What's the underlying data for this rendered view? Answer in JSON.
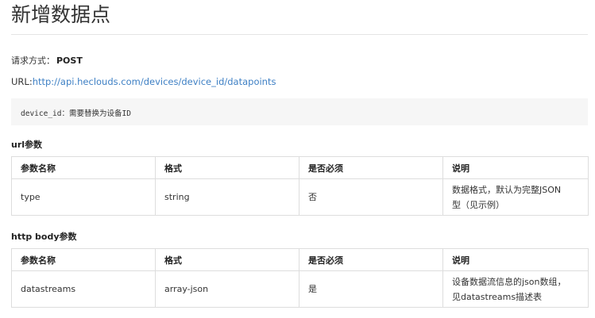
{
  "page": {
    "title": "新增数据点",
    "method_label": "请求方式：",
    "method_value": "POST",
    "url_label": "URL:",
    "url_value": "http://api.heclouds.com/devices/device_id/datapoints",
    "code_note": "device_id：需要替换为设备ID"
  },
  "url_params": {
    "heading": "url参数",
    "headers": [
      "参数名称",
      "格式",
      "是否必须",
      "说明"
    ],
    "rows": [
      {
        "name": "type",
        "format": "string",
        "required": "否",
        "desc1": "数据格式，默认为完整JSON",
        "desc2": "型（见示例）"
      }
    ]
  },
  "body_params": {
    "heading": "http body参数",
    "headers": [
      "参数名称",
      "格式",
      "是否必须",
      "说明"
    ],
    "rows": [
      {
        "name": "datastreams",
        "format": "array-json",
        "required": "是",
        "desc1": "设备数据流信息的json数组，",
        "desc2": "见datastreams描述表"
      }
    ]
  }
}
